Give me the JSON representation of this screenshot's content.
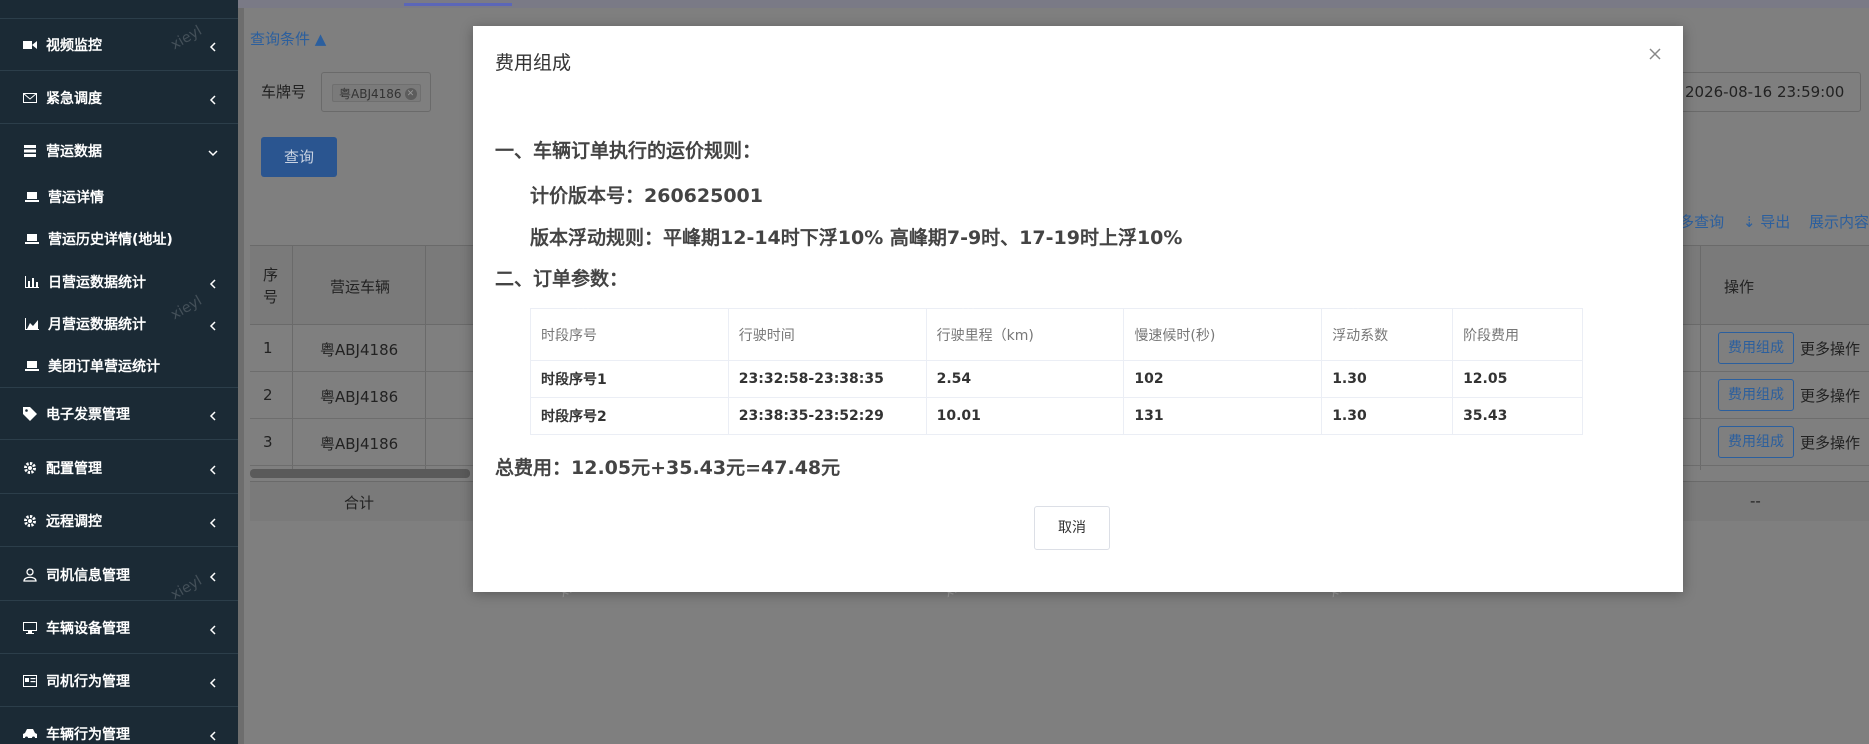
{
  "sidebar": {
    "items": [
      {
        "label": "视频监控",
        "icon": "video-icon",
        "type": "group"
      },
      {
        "label": "紧急调度",
        "icon": "mail-icon",
        "type": "group"
      },
      {
        "label": "营运数据",
        "icon": "list-icon",
        "type": "group-open"
      },
      {
        "label": "营运详情",
        "icon": "laptop-icon",
        "type": "sub"
      },
      {
        "label": "营运历史详情(地址)",
        "icon": "laptop-icon",
        "type": "sub"
      },
      {
        "label": "日营运数据统计",
        "icon": "bar-chart-icon",
        "type": "sub"
      },
      {
        "label": "月营运数据统计",
        "icon": "area-chart-icon",
        "type": "sub"
      },
      {
        "label": "美团订单营运统计",
        "icon": "laptop-icon",
        "type": "sub"
      },
      {
        "label": "电子发票管理",
        "icon": "tag-icon",
        "type": "group"
      },
      {
        "label": "配置管理",
        "icon": "gear-icon",
        "type": "group"
      },
      {
        "label": "远程调控",
        "icon": "gear-icon",
        "type": "group"
      },
      {
        "label": "司机信息管理",
        "icon": "user-icon",
        "type": "group"
      },
      {
        "label": "车辆设备管理",
        "icon": "monitor-icon",
        "type": "group"
      },
      {
        "label": "司机行为管理",
        "icon": "id-card-icon",
        "type": "group"
      },
      {
        "label": "车辆行为管理",
        "icon": "car-icon",
        "type": "group"
      }
    ]
  },
  "background": {
    "query_conditions": "查询条件 ▲",
    "plate_label": "车牌号",
    "plate_tag": "粤ABJ4186",
    "date_value": "2026-08-16 23:59:00",
    "query_button": "查询",
    "toolbar": {
      "more_query": "多查询",
      "export": "⇣ 导出",
      "display": "展示内容"
    },
    "table": {
      "headers": {
        "index": "序号",
        "vehicle": "营运车辆",
        "op": "操作"
      },
      "rows": [
        {
          "index": "1",
          "vehicle": "粤ABJ4186"
        },
        {
          "index": "2",
          "vehicle": "粤ABJ4186"
        },
        {
          "index": "3",
          "vehicle": "粤ABJ4186"
        }
      ],
      "op_button": "费用组成",
      "op_more": "更多操作",
      "sum_label": "合计",
      "sum_op": "--"
    }
  },
  "watermark": "xieyl",
  "modal": {
    "title": "费用组成",
    "section1": "一、车辆订单执行的运价规则：",
    "price_version": "计价版本号：260625001",
    "float_rule": "版本浮动规则：平峰期12-14时下浮10% 高峰期7-9时、17-19时上浮10%",
    "section2": "二、订单参数：",
    "segments": {
      "headers": [
        "时段序号",
        "行驶时间",
        "行驶里程（km)",
        "慢速候时(秒)",
        "浮动系数",
        "阶段费用"
      ],
      "rows": [
        [
          "时段序号1",
          "23:32:58-23:38:35",
          "2.54",
          "102",
          "1.30",
          "12.05"
        ],
        [
          "时段序号2",
          "23:38:35-23:52:29",
          "10.01",
          "131",
          "1.30",
          "35.43"
        ]
      ]
    },
    "total": "总费用：12.05元+35.43元=47.48元",
    "cancel": "取消"
  }
}
